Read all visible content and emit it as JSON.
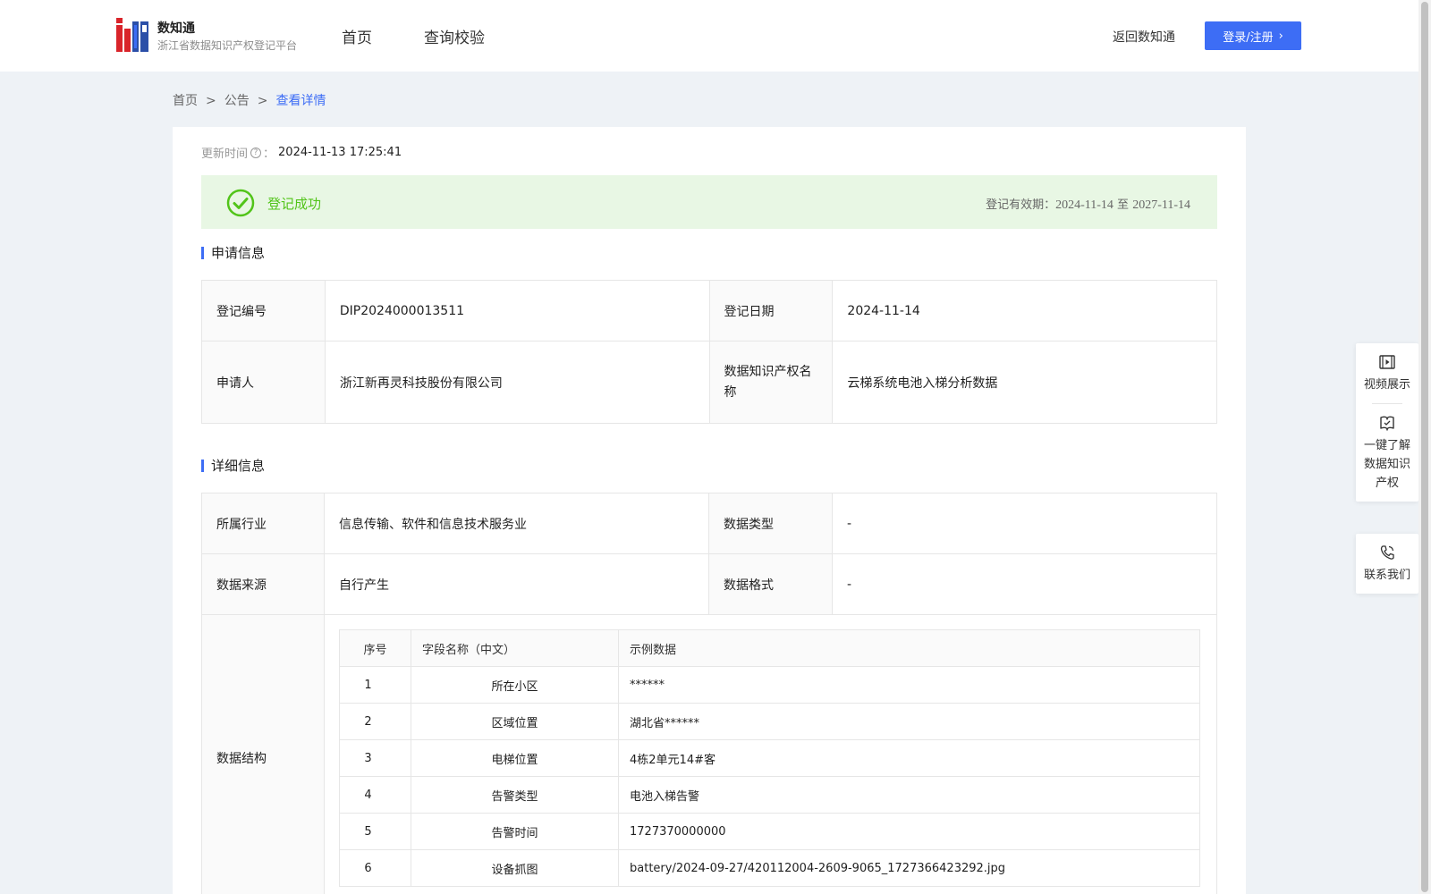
{
  "header": {
    "brand_title": "数知通",
    "brand_subtitle": "浙江省数据知识产权登记平台",
    "nav": [
      "首页",
      "查询校验"
    ],
    "back_link": "返回数知通",
    "login_label": "登录/注册"
  },
  "breadcrumb": {
    "items": [
      "首页",
      "公告"
    ],
    "current": "查看详情",
    "separator": ">"
  },
  "update": {
    "label": "更新时间",
    "colon": "：",
    "value": "2024-11-13 17:25:41"
  },
  "status": {
    "label": "登记成功",
    "valid_label": "登记有效期：",
    "valid_from": "2024-11-14",
    "valid_to_word": "至",
    "valid_to": "2027-11-14"
  },
  "apply_section": {
    "title": "申请信息",
    "rows": [
      {
        "l1": "登记编号",
        "v1": "DIP2024000013511",
        "l2": "登记日期",
        "v2": "2024-11-14"
      },
      {
        "l1": "申请人",
        "v1": "浙江新再灵科技股份有限公司",
        "l2": "数据知识产权名称",
        "v2": "云梯系统电池入梯分析数据"
      }
    ]
  },
  "detail_section": {
    "title": "详细信息",
    "rows": [
      {
        "l1": "所属行业",
        "v1": "信息传输、软件和信息技术服务业",
        "l2": "数据类型",
        "v2": "-"
      },
      {
        "l1": "数据来源",
        "v1": "自行产生",
        "l2": "数据格式",
        "v2": "-"
      }
    ],
    "structure_label": "数据结构",
    "fields_header": [
      "序号",
      "字段名称（中文）",
      "示例数据"
    ],
    "fields": [
      {
        "no": "1",
        "name": "所在小区",
        "sample": "******"
      },
      {
        "no": "2",
        "name": "区域位置",
        "sample": "湖北省******"
      },
      {
        "no": "3",
        "name": "电梯位置",
        "sample": "4栋2单元14#客"
      },
      {
        "no": "4",
        "name": "告警类型",
        "sample": "电池入梯告警"
      },
      {
        "no": "5",
        "name": "告警时间",
        "sample": "1727370000000"
      },
      {
        "no": "6",
        "name": "设备抓图",
        "sample": "battery/2024-09-27/420112004-2609-9065_1727366423292.jpg"
      }
    ]
  },
  "float_panel": {
    "video": "视频展示",
    "learn": [
      "一键了解",
      "数据知识",
      "产权"
    ],
    "contact": "联系我们"
  },
  "colors": {
    "accent": "#3d6df5",
    "success": "#52c41a",
    "success_bg": "#e8f7e4",
    "page_bg": "#eef2f6"
  }
}
